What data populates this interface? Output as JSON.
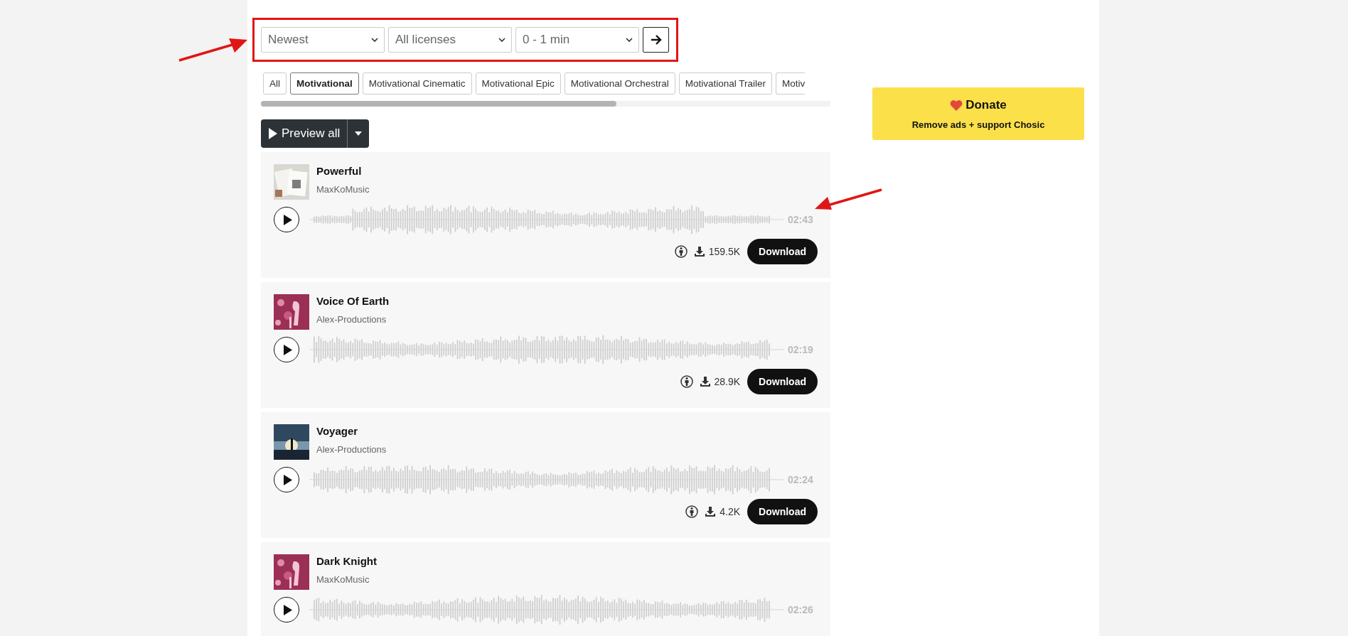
{
  "filters": {
    "selects": [
      {
        "value": "Newest"
      },
      {
        "value": "All licenses"
      },
      {
        "value": "0 - 1 min"
      }
    ]
  },
  "genres": [
    {
      "label": "All",
      "selected": false
    },
    {
      "label": "Motivational",
      "selected": true
    },
    {
      "label": "Motivational Cinematic",
      "selected": false
    },
    {
      "label": "Motivational Epic",
      "selected": false
    },
    {
      "label": "Motivational Orchestral",
      "selected": false
    },
    {
      "label": "Motivational Trailer",
      "selected": false
    },
    {
      "label": "Motiv",
      "selected": false
    }
  ],
  "preview_button": "Preview all",
  "tracks": [
    {
      "title": "Powerful",
      "artist": "MaxKoMusic",
      "duration": "02:43",
      "downloads": "159.5K",
      "download": "Download"
    },
    {
      "title": "Voice Of Earth",
      "artist": "Alex-Productions",
      "duration": "02:19",
      "downloads": "28.9K",
      "download": "Download"
    },
    {
      "title": "Voyager",
      "artist": "Alex-Productions",
      "duration": "02:24",
      "downloads": "4.2K",
      "download": "Download"
    },
    {
      "title": "Dark Knight",
      "artist": "MaxKoMusic",
      "duration": "02:26"
    }
  ],
  "donate": {
    "title": "Donate",
    "subtitle": "Remove ads + support Chosic"
  }
}
